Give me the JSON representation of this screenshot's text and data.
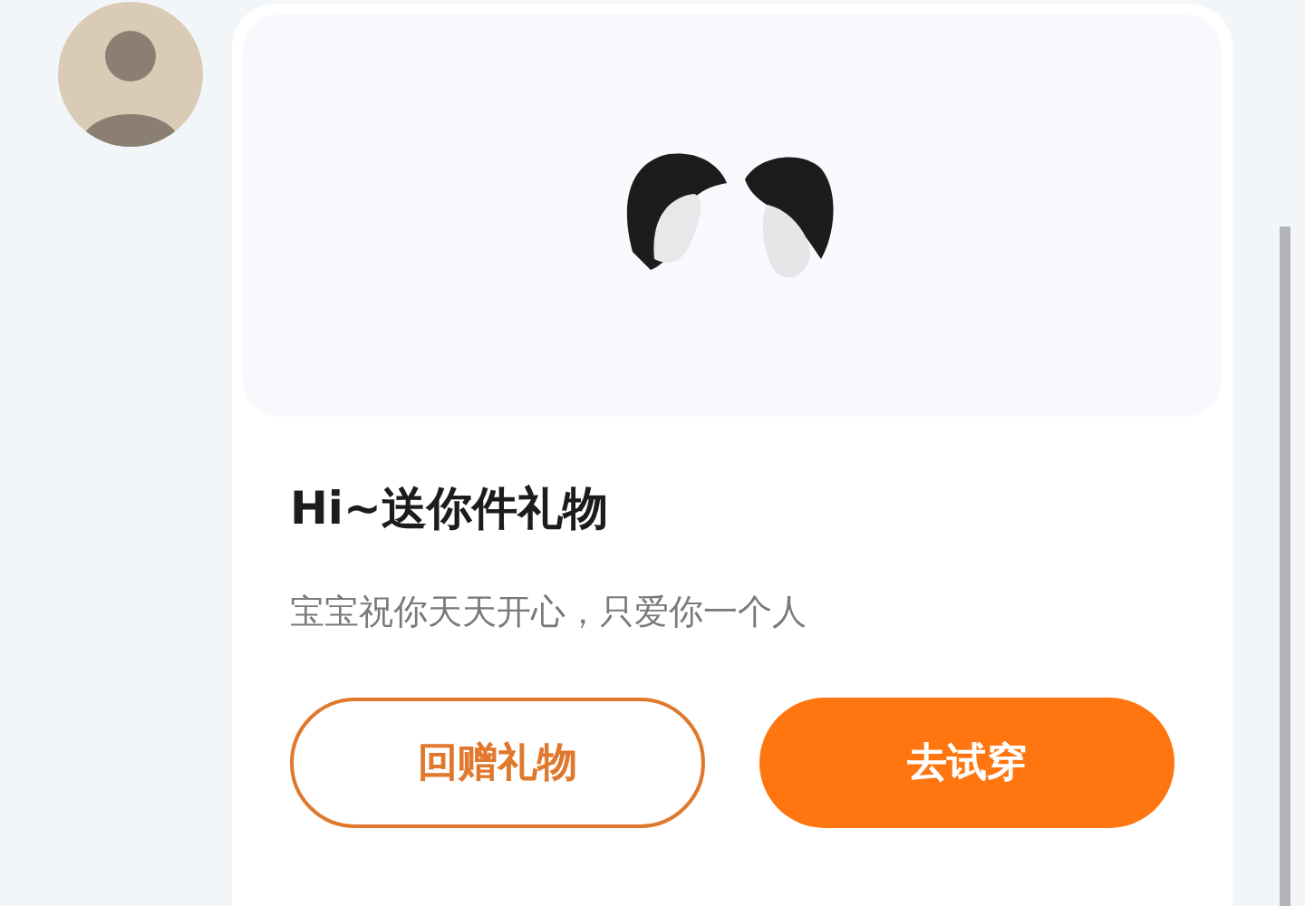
{
  "gift_card": {
    "title": "Hi~送你件礼物",
    "message": "宝宝祝你天天开心，只爱你一个人",
    "buttons": [
      {
        "label": "回赠礼物",
        "kind": "outline"
      },
      {
        "label": "去试穿",
        "kind": "filled"
      }
    ]
  }
}
